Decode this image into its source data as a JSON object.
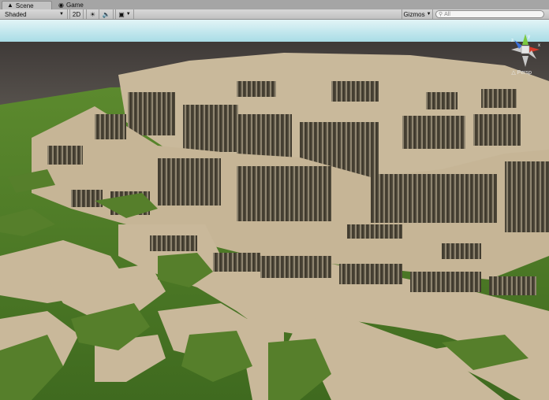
{
  "tabs": [
    {
      "label": "Scene",
      "icon": "scene-icon",
      "active": true
    },
    {
      "label": "Game",
      "icon": "game-icon",
      "active": false
    }
  ],
  "toolbar": {
    "shading_mode": "Shaded",
    "mode_2d_label": "2D",
    "lighting_icon": "sun-icon",
    "audio_icon": "speaker-icon",
    "effects_icon": "image-icon",
    "gizmos_label": "Gizmos",
    "search_placeholder": "All"
  },
  "scene_gizmo": {
    "projection_label": "Persp",
    "axes": {
      "x": "x",
      "y": "y",
      "z": "z"
    }
  },
  "colors": {
    "sky_top": "#bfe6ee",
    "horizon": "#47423f",
    "terrain_sand": "#c8b99a",
    "terrain_shadow": "#4a4436",
    "grass": "#4f7a2a"
  }
}
